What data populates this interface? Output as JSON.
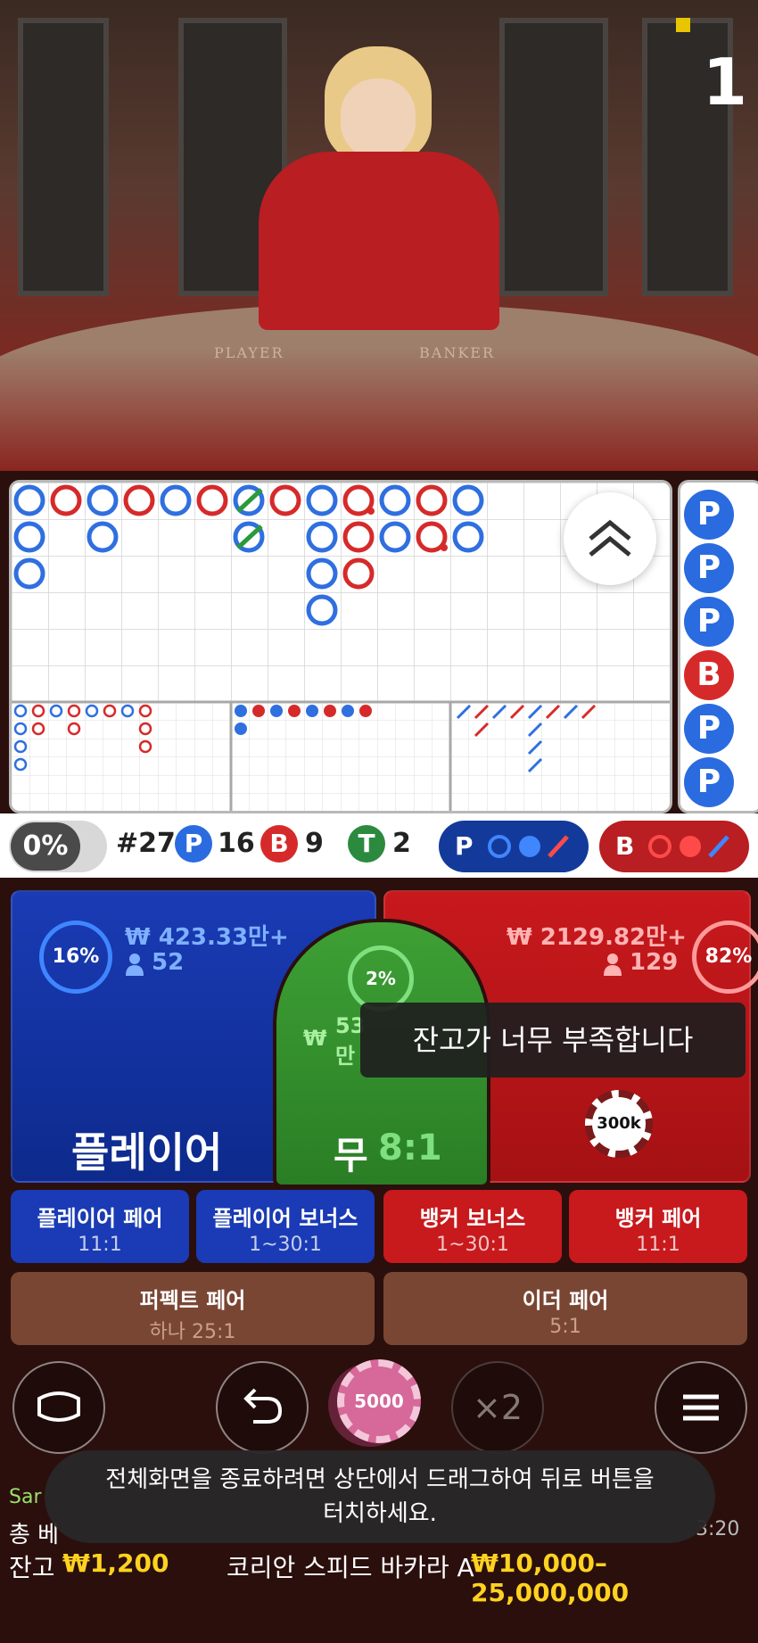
{
  "video": {
    "round_number": "1",
    "table_left_label": "PLAYER",
    "table_right_label": "BANKER"
  },
  "stats": {
    "percent_toggle": "0%",
    "round": "#27",
    "player_letter": "P",
    "player_count": "16",
    "banker_letter": "B",
    "banker_count": "9",
    "tie_letter": "T",
    "tie_count": "2",
    "player_predict_letter": "P",
    "banker_predict_letter": "B"
  },
  "bead_road": [
    "P",
    "P",
    "P",
    "B",
    "P",
    "P"
  ],
  "betting": {
    "player": {
      "percent": "16%",
      "amount": "₩ 423.33만+",
      "players": "52",
      "label": "플레이어"
    },
    "banker": {
      "percent": "82%",
      "amount": "₩ 2129.82만+",
      "players": "129",
      "chip": "300k"
    },
    "tie": {
      "percent": "2%",
      "amount_partial": "₩",
      "amount_line1": "53",
      "amount_line2": "만",
      "label": "무",
      "odds": "8:1"
    },
    "side_bets": [
      {
        "title": "플레이어 페어",
        "odds": "11:1"
      },
      {
        "title": "플레이어 보너스",
        "odds": "1~30:1"
      },
      {
        "title": "뱅커 보너스",
        "odds": "1~30:1"
      },
      {
        "title": "뱅커 페어",
        "odds": "11:1"
      }
    ],
    "extra_bets": [
      {
        "title": "퍼펙트 페어",
        "odds": "하나 25:1"
      },
      {
        "title": "이더 페어",
        "odds": "5:1"
      }
    ]
  },
  "controls": {
    "chip_value": "5000",
    "double_label": "×2"
  },
  "toasts": {
    "low_balance": "잔고가 너무 부족합니다",
    "exit_fullscreen_line1": "전체화면을 종료하려면 상단에서 드래그하여 뒤로 버튼을",
    "exit_fullscreen_line2": "터치하세요."
  },
  "footer": {
    "user_partial": "Sar",
    "total_bet_partial": "총 베",
    "time_partial": "3:20",
    "balance_label": "잔고",
    "balance_value": "₩1,200",
    "table_name": "코리안 스피드 바카라 A",
    "limits": "₩10,000–25,000,000"
  },
  "colors": {
    "player_blue": "#1f56d8",
    "banker_red": "#d3201f",
    "tie_green": "#2b8a3e",
    "gold": "#ffd21f"
  }
}
